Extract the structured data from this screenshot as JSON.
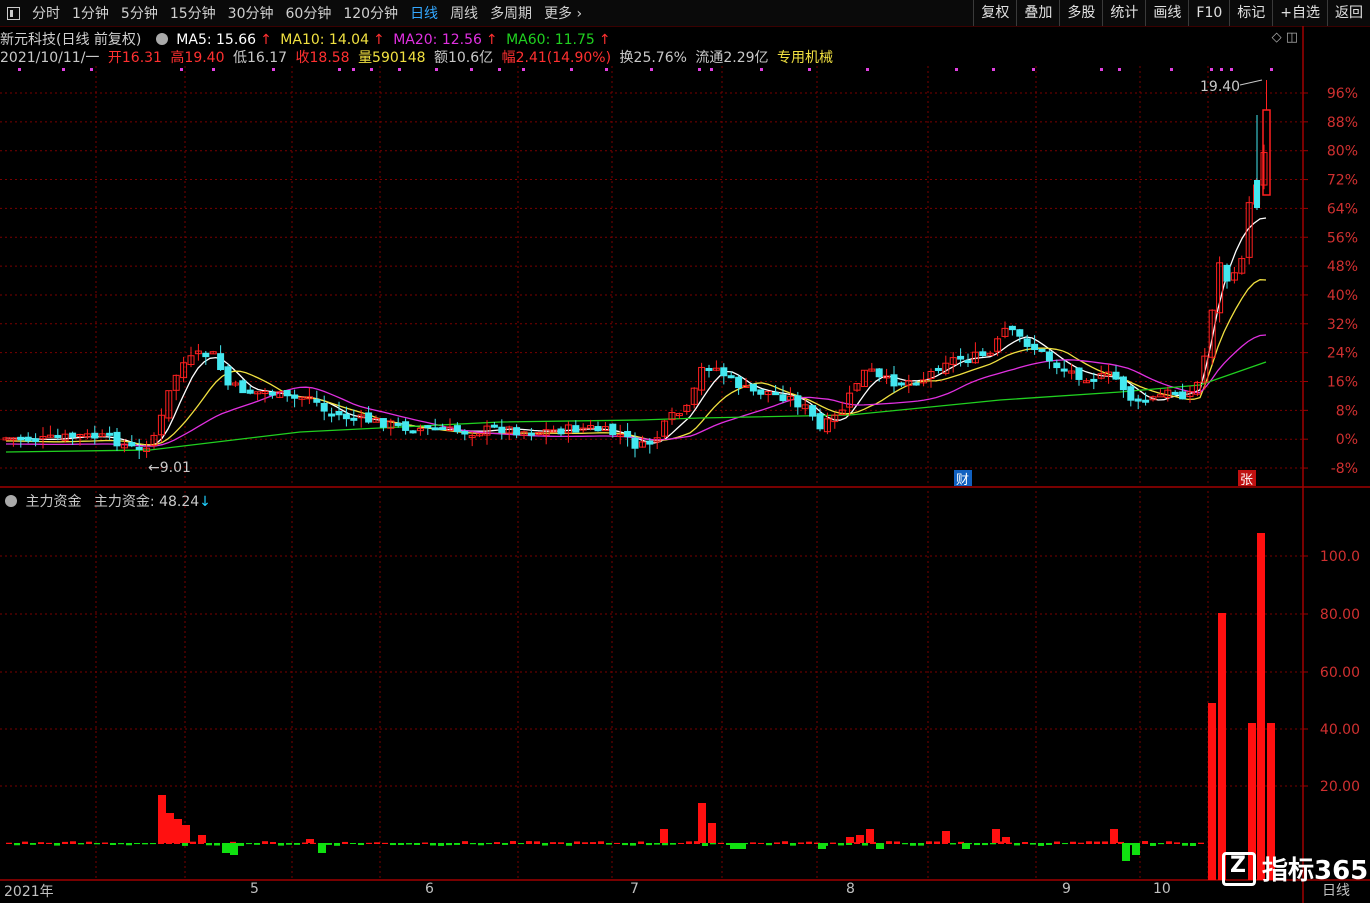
{
  "toolbar": {
    "periods": [
      "分时",
      "1分钟",
      "5分钟",
      "15分钟",
      "30分钟",
      "60分钟",
      "120分钟",
      "日线",
      "周线",
      "多周期",
      "更多"
    ],
    "active_period": "日线",
    "right_buttons": [
      "复权",
      "叠加",
      "多股",
      "统计",
      "画线",
      "F10",
      "标记",
      "+自选",
      "返回"
    ]
  },
  "stock": {
    "name": "新元科技(日线 前复权)",
    "ma5_label": "MA5: 15.66",
    "ma10_label": "MA10: 14.04",
    "ma20_label": "MA20: 12.56",
    "ma60_label": "MA60: 11.75",
    "date": "2021/10/11/一",
    "open": "开16.31",
    "high": "高19.40",
    "low": "低16.17",
    "close": "收18.58",
    "volume": "量590148",
    "amount": "额10.6亿",
    "change": "幅2.41(14.90%)",
    "turnover": "换25.76%",
    "float": "流通2.29亿",
    "industry": "专用机械"
  },
  "main_chart": {
    "y_axis_labels": [
      "96%",
      "88%",
      "80%",
      "72%",
      "64%",
      "56%",
      "48%",
      "40%",
      "32%",
      "24%",
      "16%",
      "8%",
      "0%",
      "-8%"
    ],
    "max_label": "19.40",
    "min_label": "9.01",
    "event_markers": [
      "财",
      "张"
    ]
  },
  "sub_chart": {
    "title": "主力资金",
    "value_label": "主力资金: 48.24",
    "y_axis_labels": [
      "100.0",
      "80.00",
      "60.00",
      "40.00",
      "20.00"
    ]
  },
  "x_axis": {
    "labels": [
      "2021年",
      "5",
      "6",
      "7",
      "8",
      "9",
      "10"
    ]
  },
  "logo": {
    "text": "指标365",
    "corner": "日线"
  },
  "colors": {
    "up": "#ff2020",
    "down": "#44e8f0",
    "ma5": "#ffffff",
    "ma10": "#f0e040",
    "ma20": "#e030e0",
    "ma60": "#20d020",
    "flow_up": "#ff1010",
    "flow_down": "#10e010",
    "grid": "#7a0000"
  }
}
